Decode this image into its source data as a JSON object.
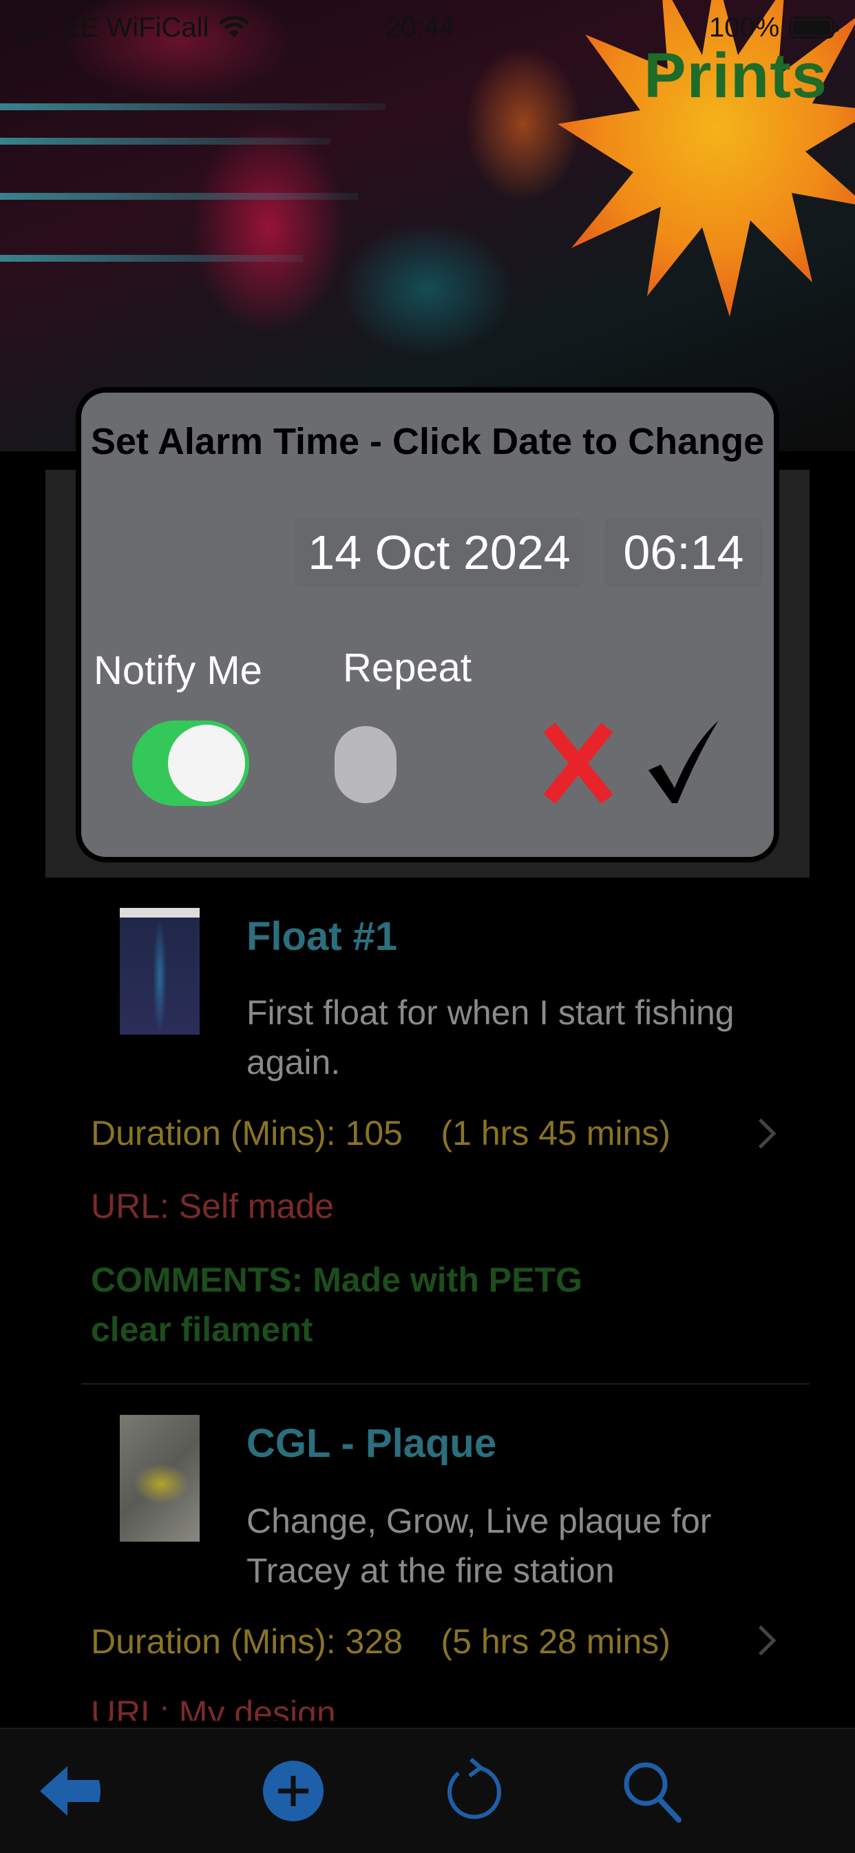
{
  "status_bar": {
    "carrier": "EE WiFiCall",
    "time": "20:44",
    "battery": "100%"
  },
  "header": {
    "brand_text": "Prints"
  },
  "alarm_modal": {
    "title": "Set Alarm Time - Click Date to Change",
    "date": "14 Oct 2024",
    "time": "06:14",
    "notify_label": "Notify Me",
    "notify_on": true,
    "repeat_label": "Repeat",
    "repeat_on": false
  },
  "prints": [
    {
      "title": "Float #1",
      "description": "First float for when I start fishing again.",
      "duration": "Duration (Mins): 105    (1 hrs 45 mins)",
      "url": "URL: Self made",
      "comments": "COMMENTS: Made with PETG clear filament"
    },
    {
      "title": "CGL - Plaque",
      "description": "Change, Grow, Live plaque for Tracey at the fire station",
      "duration": "Duration (Mins): 328    (5 hrs 28 mins)",
      "url": "URL: My design"
    }
  ],
  "toolbar": {
    "icons": [
      "back-arrow-icon",
      "add-icon",
      "refresh-icon",
      "search-icon"
    ],
    "accent_color": "#1d5fa8"
  },
  "colors": {
    "title_teal": "#2b6f7e",
    "duration_gold": "#8a7424",
    "url_red": "#7a2a2a",
    "comments_green": "#1c4d1c",
    "toggle_green": "#34c759",
    "cancel_red": "#e8232a"
  }
}
